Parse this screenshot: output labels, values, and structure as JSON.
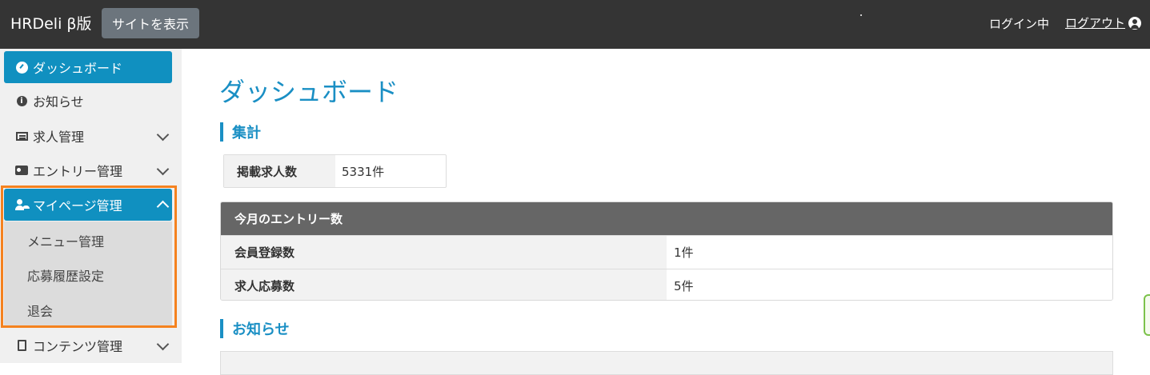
{
  "header": {
    "brand": "HRDeli β版",
    "view_site_label": "サイトを表示",
    "login_status": "ログイン中",
    "logout_label": "ログアウト"
  },
  "sidebar": {
    "items": [
      {
        "label": "ダッシュボード",
        "icon": "dashboard-icon"
      },
      {
        "label": "お知らせ",
        "icon": "info-icon"
      },
      {
        "label": "求人管理",
        "icon": "list-icon"
      },
      {
        "label": "エントリー管理",
        "icon": "id-card-icon"
      },
      {
        "label": "マイページ管理",
        "icon": "user-cog-icon"
      },
      {
        "label": "コンテンツ管理",
        "icon": "file-icon"
      }
    ],
    "mypage_sub": [
      "メニュー管理",
      "応募履歴設定",
      "退会"
    ]
  },
  "main": {
    "title": "ダッシュボード",
    "summary_heading": "集計",
    "job_count_label": "掲載求人数",
    "job_count_value": "5331件",
    "entry_table": {
      "heading": "今月のエントリー数",
      "rows": [
        {
          "label": "会員登録数",
          "value": "1件"
        },
        {
          "label": "求人応募数",
          "value": "5件"
        }
      ]
    },
    "news_heading": "お知らせ"
  },
  "colors": {
    "accent": "#1a8fc4",
    "highlight": "#f5821f",
    "topbar": "#343434"
  }
}
